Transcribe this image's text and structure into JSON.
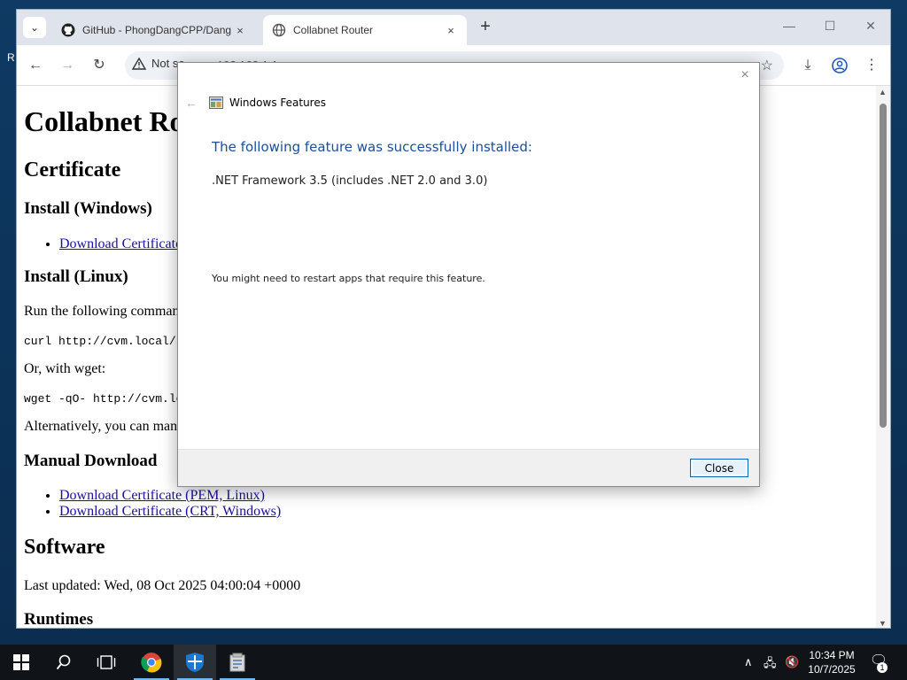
{
  "desktop": {
    "icon_label": "R"
  },
  "browser": {
    "tabs": [
      {
        "title": "GitHub - PhongDangCPP/Dang",
        "close": "×"
      },
      {
        "title": "Collabnet Router",
        "close": "×"
      }
    ],
    "new_tab": "+",
    "window_controls": {
      "minimize": "—",
      "maximize": "☐",
      "close": "✕"
    },
    "address": {
      "security_text": "Not se",
      "url": "192.168.1.1"
    }
  },
  "page": {
    "title": "Collabnet Ro",
    "certificate_heading": "Certificate",
    "install_windows_heading": "Install (Windows)",
    "install_windows_link": "Download Certificate",
    "install_linux_heading": "Install (Linux)",
    "run_following": "Run the following comman",
    "curl_cmd": "curl http://cvm.local/l",
    "or_wget": "Or, with wget:",
    "wget_cmd": "wget -qO- http://cvm.loca",
    "alternatively": "Alternatively, you can man",
    "manual_download_heading": "Manual Download",
    "manual_links": [
      "Download Certificate (PEM, Linux)",
      "Download Certificate (CRT, Windows)"
    ],
    "software_heading": "Software",
    "last_updated": "Last updated: Wed, 08 Oct 2025 04:00:04 +0000",
    "runtimes_heading": "Runtimes"
  },
  "dialog": {
    "title": "Windows Features",
    "heading": "The following feature was successfully installed:",
    "feature": ".NET Framework 3.5 (includes .NET 2.0 and 3.0)",
    "note": "You might need to restart apps that require this feature.",
    "close_button": "Close"
  },
  "taskbar": {
    "time": "10:34 PM",
    "date": "10/7/2025",
    "notification_count": "1"
  },
  "colors": {
    "dialog_heading": "#1a4f9c",
    "link": "#1a0dab",
    "taskbar": "#101418"
  }
}
